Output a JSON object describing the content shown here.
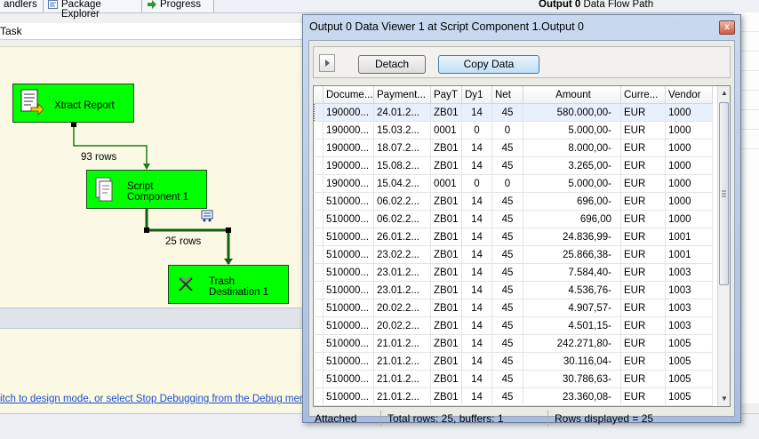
{
  "ide": {
    "tabs": [
      {
        "label": "andlers"
      },
      {
        "label": "Package Explorer"
      },
      {
        "label": "Progress"
      }
    ],
    "right_header": {
      "bold": "Output 0",
      "text": "Data Flow Path"
    },
    "task_label": "Task",
    "components": {
      "xtract": "Xtract Report",
      "script": "Script Component 1",
      "trash": "Trash Destination 1"
    },
    "flows": {
      "first": "93 rows",
      "second": "25 rows"
    },
    "hint": "itch to design mode, or select Stop Debugging from the Debug menu."
  },
  "viewer": {
    "title": "Output 0 Data Viewer 1 at Script Component 1.Output 0",
    "close_glyph": "x",
    "detach_label": "Detach",
    "copy_label": "Copy Data",
    "columns": [
      "Docume...",
      "Payment...",
      "PayT",
      "Dy1",
      "Net",
      "Amount",
      "Curre...",
      "Vendor"
    ],
    "rows": [
      [
        "190000...",
        "24.01.2...",
        "ZB01",
        "14",
        "45",
        "580.000,00-",
        "EUR",
        "1000"
      ],
      [
        "190000...",
        "15.03.2...",
        "0001",
        "0",
        "0",
        "5.000,00-",
        "EUR",
        "1000"
      ],
      [
        "190000...",
        "18.07.2...",
        "ZB01",
        "14",
        "45",
        "8.000,00-",
        "EUR",
        "1000"
      ],
      [
        "190000...",
        "15.08.2...",
        "ZB01",
        "14",
        "45",
        "3.265,00-",
        "EUR",
        "1000"
      ],
      [
        "190000...",
        "15.04.2...",
        "0001",
        "0",
        "0",
        "5.000,00-",
        "EUR",
        "1000"
      ],
      [
        "510000...",
        "06.02.2...",
        "ZB01",
        "14",
        "45",
        "696,00-",
        "EUR",
        "1000"
      ],
      [
        "510000...",
        "06.02.2...",
        "ZB01",
        "14",
        "45",
        "696,00",
        "EUR",
        "1000"
      ],
      [
        "510000...",
        "26.01.2...",
        "ZB01",
        "14",
        "45",
        "24.836,99-",
        "EUR",
        "1001"
      ],
      [
        "510000...",
        "23.02.2...",
        "ZB01",
        "14",
        "45",
        "25.866,38-",
        "EUR",
        "1001"
      ],
      [
        "510000...",
        "23.01.2...",
        "ZB01",
        "14",
        "45",
        "7.584,40-",
        "EUR",
        "1003"
      ],
      [
        "510000...",
        "23.01.2...",
        "ZB01",
        "14",
        "45",
        "4.536,76-",
        "EUR",
        "1003"
      ],
      [
        "510000...",
        "20.02.2...",
        "ZB01",
        "14",
        "45",
        "4.907,57-",
        "EUR",
        "1003"
      ],
      [
        "510000...",
        "20.02.2...",
        "ZB01",
        "14",
        "45",
        "4.501,15-",
        "EUR",
        "1003"
      ],
      [
        "510000...",
        "21.01.2...",
        "ZB01",
        "14",
        "45",
        "242.271,80-",
        "EUR",
        "1005"
      ],
      [
        "510000...",
        "21.01.2...",
        "ZB01",
        "14",
        "45",
        "30.116,04-",
        "EUR",
        "1005"
      ],
      [
        "510000...",
        "21.01.2...",
        "ZB01",
        "14",
        "45",
        "30.786,63-",
        "EUR",
        "1005"
      ],
      [
        "510000...",
        "21.01.2...",
        "ZB01",
        "14",
        "45",
        "23.360,08-",
        "EUR",
        "1005"
      ]
    ],
    "status": {
      "attached": "Attached",
      "total": "Total rows: 25, buffers: 1",
      "displayed": "Rows displayed = 25"
    }
  },
  "colors": {
    "component_fill": "#00ff00",
    "canvas": "#fbf9e4",
    "link": "#1b4ecb"
  }
}
